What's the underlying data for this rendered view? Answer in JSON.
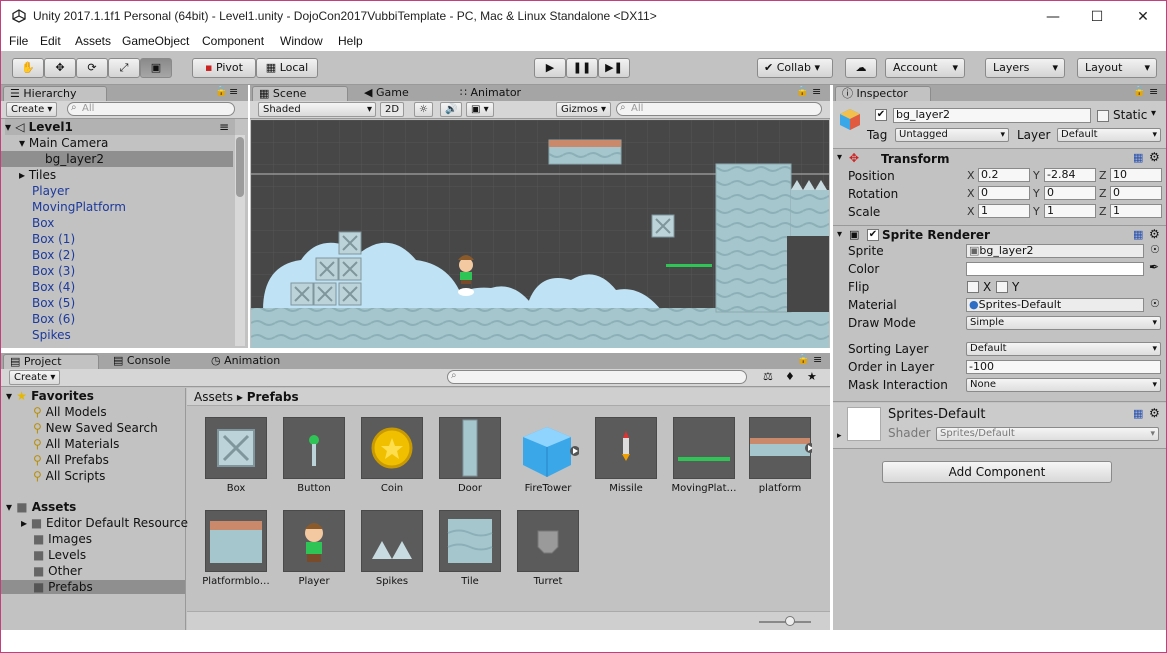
{
  "window": {
    "title": "Unity 2017.1.1f1 Personal (64bit) - Level1.unity - DojoCon2017VubbiTemplate - PC, Mac & Linux Standalone <DX11>"
  },
  "menu": [
    "File",
    "Edit",
    "Assets",
    "GameObject",
    "Component",
    "Window",
    "Help"
  ],
  "toolbar": {
    "pivot": "Pivot",
    "local": "Local",
    "collab": "Collab",
    "account": "Account",
    "layers": "Layers",
    "layout": "Layout"
  },
  "hierarchy": {
    "tab": "Hierarchy",
    "create": "Create",
    "search_placeholder": "All",
    "scene": "Level1",
    "items": [
      "Main Camera",
      "bg_layer2",
      "Tiles",
      "Player",
      "MovingPlatform",
      "Box",
      "Box (1)",
      "Box (2)",
      "Box (3)",
      "Box (4)",
      "Box (5)",
      "Box (6)",
      "Spikes"
    ]
  },
  "scene": {
    "tabs": [
      "Scene",
      "Game",
      "Animator"
    ],
    "shading": "Shaded",
    "mode2d": "2D",
    "gizmos": "Gizmos",
    "search_placeholder": "All"
  },
  "project": {
    "tabs": [
      "Project",
      "Console",
      "Animation"
    ],
    "create": "Create",
    "favorites_label": "Favorites",
    "favorites": [
      "All Models",
      "New Saved Search",
      "All Materials",
      "All Prefabs",
      "All Scripts"
    ],
    "assets_label": "Assets",
    "folders": [
      "Editor Default Resource",
      "Images",
      "Levels",
      "Other",
      "Prefabs"
    ],
    "breadcrumb": [
      "Assets",
      "Prefabs"
    ],
    "items": [
      "Box",
      "Button",
      "Coin",
      "Door",
      "FireTower",
      "Missile",
      "MovingPlat…",
      "platform",
      "Platformblo…",
      "Player",
      "Spikes",
      "Tile",
      "Turret"
    ]
  },
  "inspector": {
    "tab": "Inspector",
    "object_name": "bg_layer2",
    "static_label": "Static",
    "tag_label": "Tag",
    "tag": "Untagged",
    "layer_label": "Layer",
    "layer": "Default",
    "transform": {
      "title": "Transform",
      "position": [
        "0.2",
        "-2.84",
        "10"
      ],
      "rotation": [
        "0",
        "0",
        "0"
      ],
      "scale": [
        "1",
        "1",
        "1"
      ],
      "labels": [
        "Position",
        "Rotation",
        "Scale"
      ]
    },
    "sprite_renderer": {
      "title": "Sprite Renderer",
      "sprite_label": "Sprite",
      "sprite": "bg_layer2",
      "color_label": "Color",
      "flip_label": "Flip",
      "flip_x": "X",
      "flip_y": "Y",
      "material_label": "Material",
      "material": "Sprites-Default",
      "draw_mode_label": "Draw Mode",
      "draw_mode": "Simple",
      "sorting_layer_label": "Sorting Layer",
      "sorting_layer": "Default",
      "order_label": "Order in Layer",
      "order": "-100",
      "mask_label": "Mask Interaction",
      "mask": "None"
    },
    "material": {
      "name": "Sprites-Default",
      "shader_label": "Shader",
      "shader": "Sprites/Default"
    },
    "add_component": "Add Component"
  },
  "colors": {
    "selection": "#8f8f8f",
    "accent_blue": "#1d3a9c",
    "scene_bg": "#474747",
    "cloud": "#bfe3f5",
    "platform": "#a6c6cd",
    "green": "#2fc456"
  }
}
